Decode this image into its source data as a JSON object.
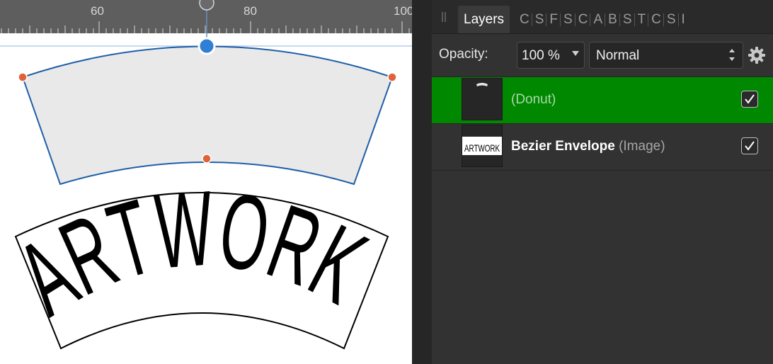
{
  "ruler": {
    "labels": [
      "60",
      "80",
      "100"
    ]
  },
  "artwork": {
    "text": "ARTWORK"
  },
  "panel": {
    "tabs": [
      {
        "label": "Layers",
        "active": true
      },
      {
        "label": "C"
      },
      {
        "label": "S"
      },
      {
        "label": "F"
      },
      {
        "label": "S"
      },
      {
        "label": "C"
      },
      {
        "label": "A"
      },
      {
        "label": "B"
      },
      {
        "label": "S"
      },
      {
        "label": "T"
      },
      {
        "label": "C"
      },
      {
        "label": "S"
      },
      {
        "label": "I"
      }
    ],
    "opacity_label": "Opacity:",
    "opacity_value": "100 %",
    "blend_mode": "Normal",
    "gear_icon": "gear-icon"
  },
  "layers": [
    {
      "name": "",
      "type": "(Donut)",
      "visible": true,
      "selected": true,
      "thumb_icon": "donut-thumbnail"
    },
    {
      "name": "Bezier Envelope",
      "type": "(Image)",
      "visible": true,
      "selected": false,
      "thumb_text": "ARTWORK"
    }
  ],
  "colors": {
    "selection_row": "#008900",
    "handle_blue": "#2f7fd4",
    "node_orange": "#e0623a",
    "shape_fill": "#e9e9e9",
    "ruler_bg": "#5e5e5e"
  }
}
